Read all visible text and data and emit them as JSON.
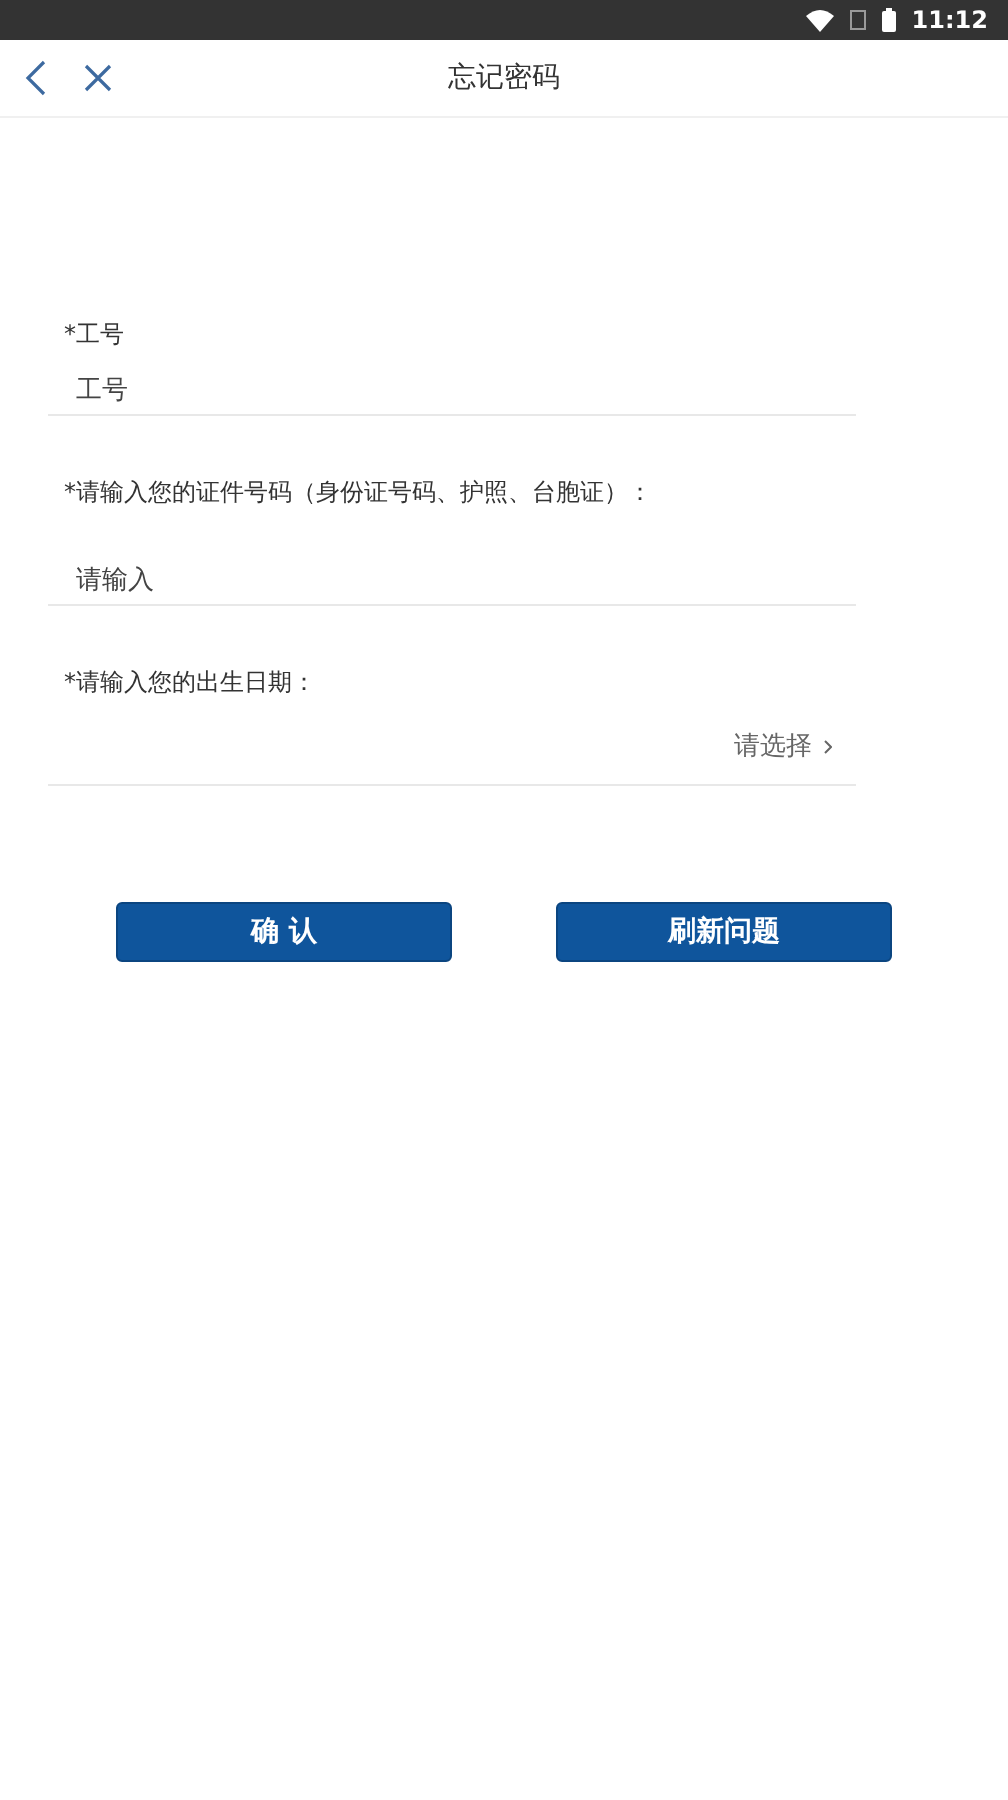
{
  "status_bar": {
    "time": "11:12"
  },
  "nav": {
    "title": "忘记密码"
  },
  "fields": [
    {
      "kind": "input",
      "label": "*工号",
      "placeholder": "工号"
    },
    {
      "kind": "input",
      "label": "*请输入您的证件号码（身份证号码、护照、台胞证）：",
      "placeholder": "请输入"
    },
    {
      "kind": "select",
      "label": "*请输入您的出生日期：",
      "placeholder": "请选择"
    }
  ],
  "buttons": [
    "确 认",
    "刷新问题"
  ]
}
